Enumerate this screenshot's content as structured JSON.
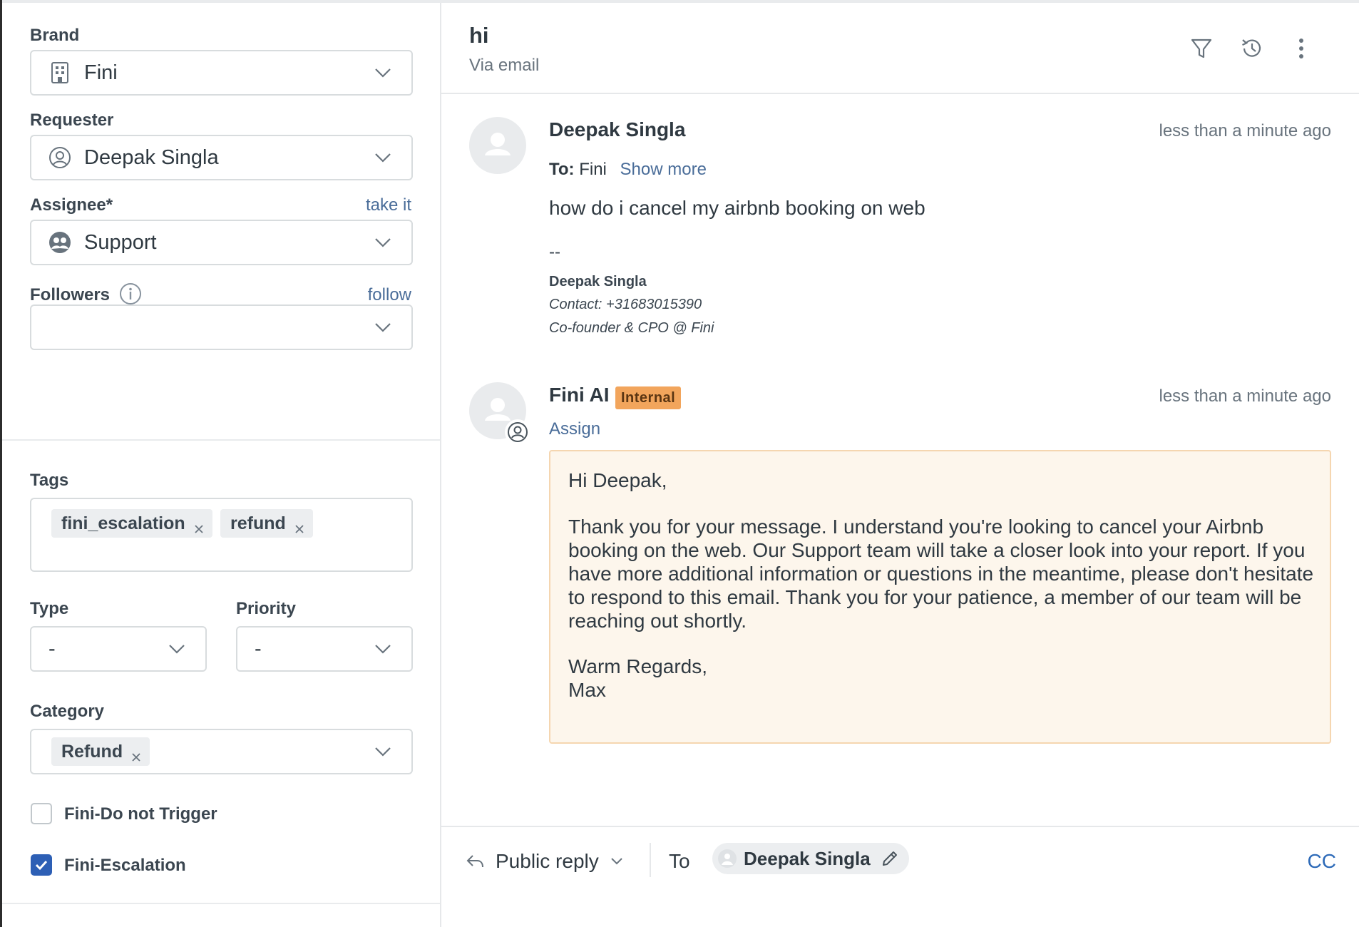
{
  "sidebar": {
    "brand": {
      "label": "Brand",
      "value": "Fini"
    },
    "requester": {
      "label": "Requester",
      "value": "Deepak Singla"
    },
    "assignee": {
      "label": "Assignee*",
      "action": "take it",
      "value": "Support"
    },
    "followers": {
      "label": "Followers",
      "action": "follow",
      "value": ""
    },
    "tags": {
      "label": "Tags",
      "items": [
        "fini_escalation",
        "refund"
      ]
    },
    "type": {
      "label": "Type",
      "value": "-"
    },
    "priority": {
      "label": "Priority",
      "value": "-"
    },
    "category": {
      "label": "Category",
      "value": "Refund"
    },
    "checkboxes": [
      {
        "label": "Fini-Do not Trigger",
        "checked": false
      },
      {
        "label": "Fini-Escalation",
        "checked": true
      }
    ]
  },
  "ticket": {
    "title": "hi",
    "subtitle": "Via email"
  },
  "messages": [
    {
      "author": "Deepak Singla",
      "time": "less than a minute ago",
      "to_label": "To:",
      "to_value": "Fini",
      "show_more": "Show more",
      "body": "how do i cancel my airbnb booking on web",
      "sig_dash": "--",
      "sig_name": "Deepak Singla",
      "sig_contact": "Contact: +31683015390",
      "sig_role": "Co-founder & CPO @ Fini"
    },
    {
      "author": "Fini AI",
      "badge": "Internal",
      "time": "less than a minute ago",
      "assign": "Assign",
      "greeting": "Hi Deepak,",
      "paragraph": "Thank you for your message. I understand you're looking to cancel your Airbnb booking on the web. Our Support team will take a closer look into your report. If you have more additional information or questions in the meantime, please don't hesitate to respond to this email. Thank you for your patience, a member of our team will be reaching out shortly.",
      "closing": "Warm Regards,",
      "signoff": "Max"
    }
  ],
  "reply": {
    "type": "Public reply",
    "to_label": "To",
    "recipient": "Deepak Singla",
    "cc": "CC"
  },
  "colors": {
    "link": "#4a6d99",
    "internal_badge": "#f2a55c",
    "note_bg": "#fdf6ec",
    "checkbox_checked": "#2d5fb5"
  }
}
